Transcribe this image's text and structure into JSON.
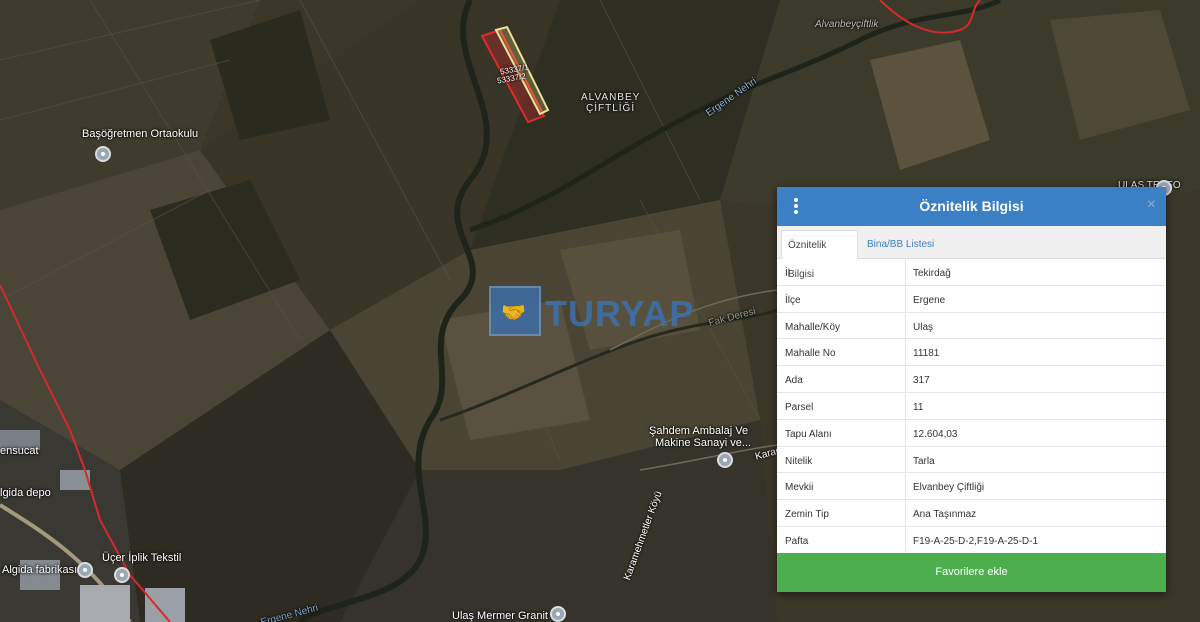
{
  "map": {
    "labels": {
      "basogretmen": "Başöğretmen Ortaokulu",
      "alvanbey1": "ALVANBEY",
      "alvanbey2": "ÇİFTLİĞİ",
      "parcel_a": "53337/1",
      "parcel_b": "53337/2",
      "ergene_nehri": "Ergene Nehri",
      "alvanbey_ciftlik": "Alvanbeyçiftlik",
      "ulas_trafo": "ULAŞ TRAFO",
      "sahdem1": "Şahdem Ambalaj Ve",
      "sahdem2": "Makine Sanayi ve...",
      "ensucat": "ensucat",
      "algida_depo": "lgida depo",
      "ucer": "Üçer İplik Tekstil",
      "algida_fabrikasi": "Algida fabrikası",
      "ulas_mermer": "Ulaş Mermer Granit",
      "karamehmetler": "Karamehmetler Köyü",
      "karamehmet_road": "Karam",
      "fak_deresi": "Fak Deresi",
      "ergene_bottom": "Ergene Nehri"
    },
    "logo_text": "TURYAP"
  },
  "panel": {
    "title": "Öznitelik Bilgisi",
    "tabs": [
      "Öznitelik Bilgisi",
      "Bina/BB Listesi"
    ],
    "rows": [
      {
        "key": "İl",
        "value": "Tekirdağ"
      },
      {
        "key": "İlçe",
        "value": "Ergene"
      },
      {
        "key": "Mahalle/Köy",
        "value": "Ulaş"
      },
      {
        "key": "Mahalle No",
        "value": "11181"
      },
      {
        "key": "Ada",
        "value": "317"
      },
      {
        "key": "Parsel",
        "value": "11"
      },
      {
        "key": "Tapu Alanı",
        "value": "12.604,03"
      },
      {
        "key": "Nitelik",
        "value": "Tarla"
      },
      {
        "key": "Mevkii",
        "value": "Elvanbey Çiftliği"
      },
      {
        "key": "Zemin Tip",
        "value": "Ana Taşınmaz"
      },
      {
        "key": "Pafta",
        "value": "F19-A-25-D-2,F19-A-25-D-1"
      }
    ],
    "favorite_button": "Favorilere ekle",
    "close_symbol": "×"
  }
}
